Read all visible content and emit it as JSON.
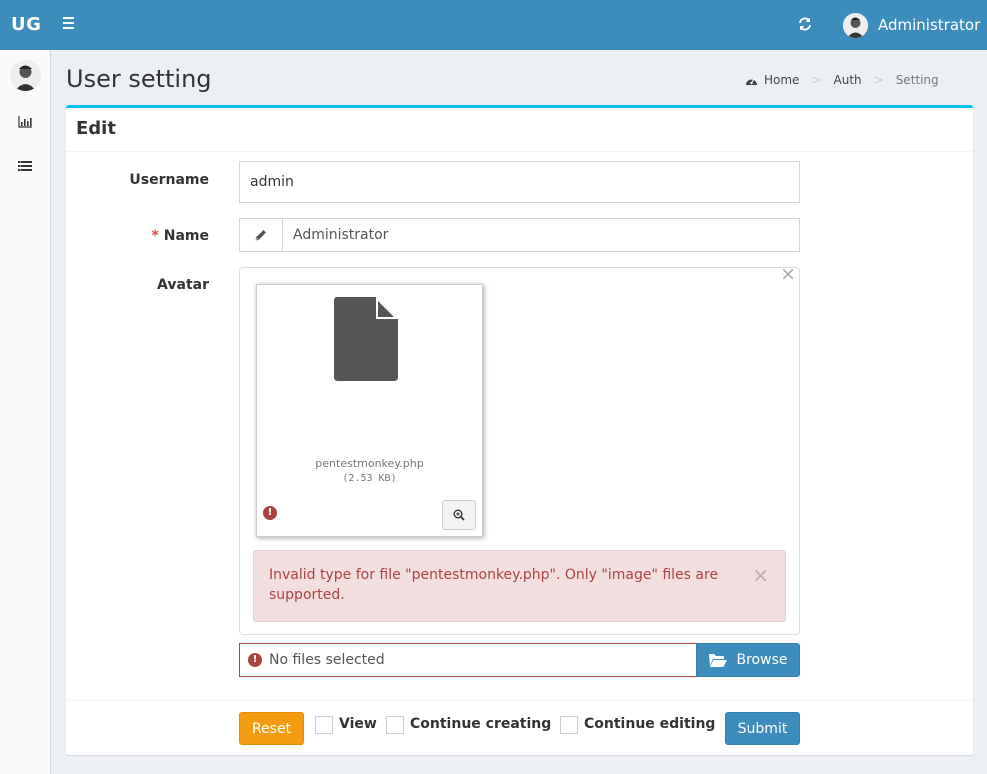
{
  "app": {
    "logo": "UG"
  },
  "header": {
    "user_name": "Administrator"
  },
  "page": {
    "title": "User setting"
  },
  "breadcrumb": {
    "home": "Home",
    "auth": "Auth",
    "current": "Setting",
    "separator": ">"
  },
  "form": {
    "box_title": "Edit",
    "username_label": "Username",
    "username_value": "admin",
    "name_required_mark": "*",
    "name_label": "Name",
    "name_value": "Administrator",
    "avatar_label": "Avatar",
    "file_close": "×",
    "preview_file_name": "pentestmonkey.php",
    "preview_file_size": "(2.53 KB)",
    "error_mark": "!",
    "alert_text": "Invalid type for file \"pentestmonkey.php\". Only \"image\" files are supported.",
    "alert_close": "×",
    "caption_text": "No files selected",
    "browse_label": "Browse"
  },
  "footer": {
    "reset_label": "Reset",
    "view_label": "View",
    "continue_creating_label": "Continue creating",
    "continue_editing_label": "Continue editing",
    "submit_label": "Submit"
  },
  "colors": {
    "navbar": "#3c8dbc",
    "box_border": "#00c0ef",
    "error": "#a94442",
    "alert_bg": "#f2dede",
    "reset": "#f39c12",
    "primary": "#3c8dbc"
  },
  "icons": {
    "menu": "hamburger-icon",
    "refresh": "refresh-icon",
    "dashboard": "bar-chart-icon",
    "list": "list-icon",
    "home": "dashboard-icon",
    "pencil": "pencil-icon",
    "file": "file-icon",
    "zoom": "zoom-in-icon",
    "folder": "folder-open-icon",
    "error": "exclamation-circle-icon"
  }
}
